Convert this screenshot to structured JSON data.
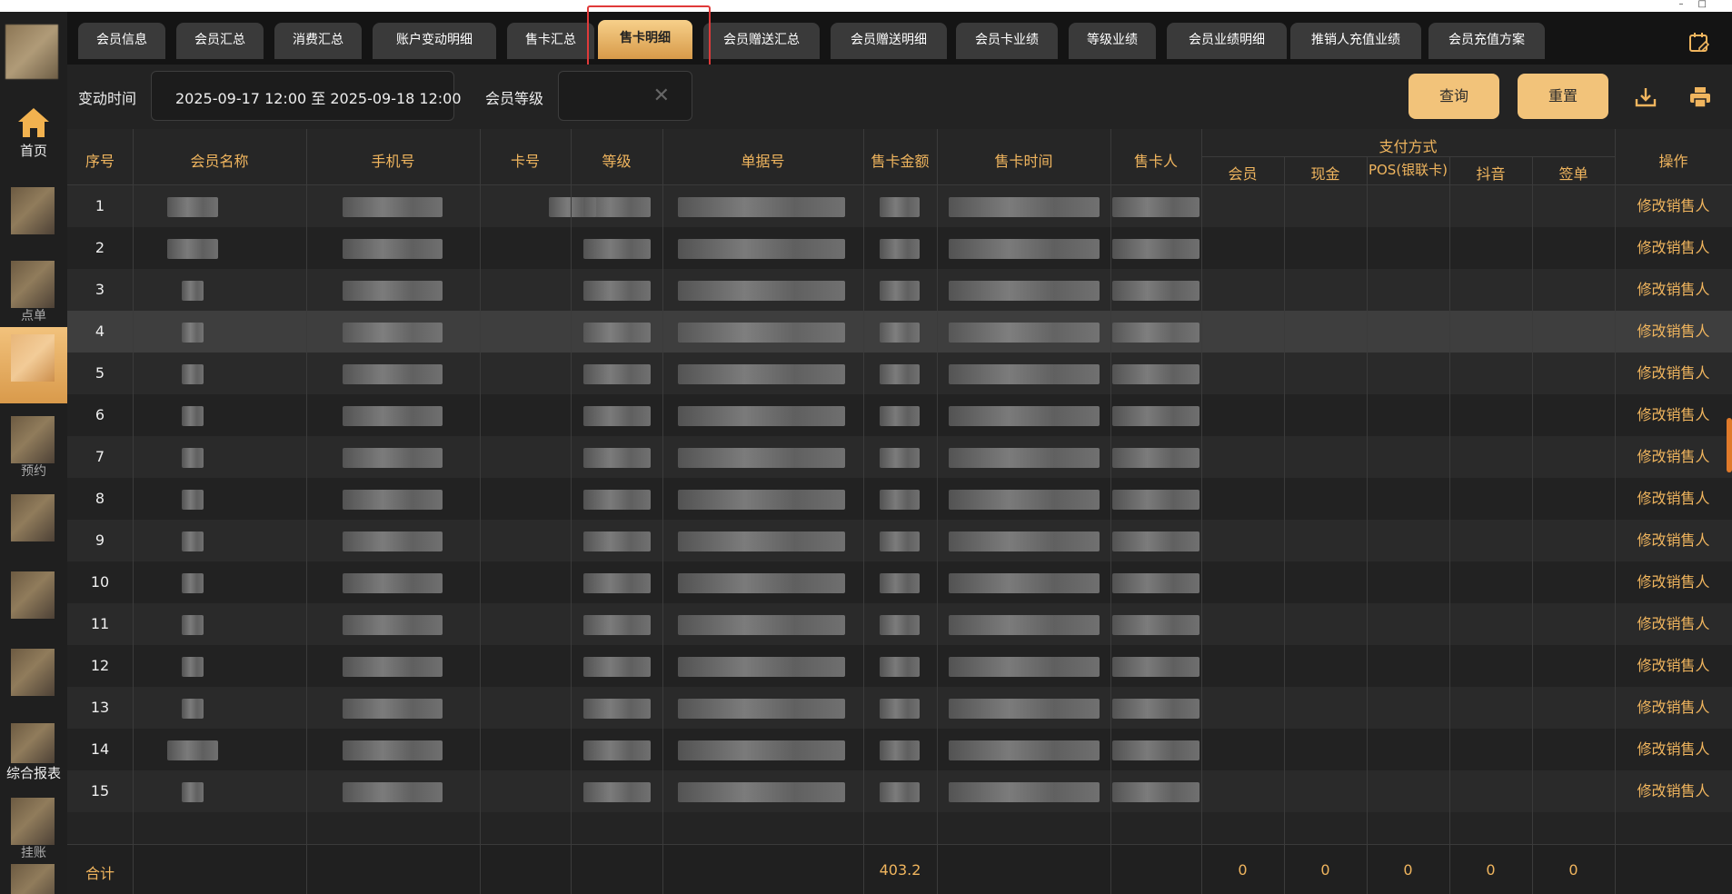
{
  "sidebar": {
    "items": [
      {
        "label": "首页",
        "icon": "home-icon"
      },
      {
        "label": ""
      },
      {
        "label": "点单"
      },
      {
        "label": ""
      },
      {
        "label": "预约"
      },
      {
        "label": ""
      },
      {
        "label": ""
      },
      {
        "label": ""
      },
      {
        "label": "综合报表"
      },
      {
        "label": "挂账"
      },
      {
        "label": ""
      }
    ]
  },
  "tabs": [
    {
      "label": "会员信息"
    },
    {
      "label": "会员汇总"
    },
    {
      "label": "消费汇总"
    },
    {
      "label": "账户变动明细"
    },
    {
      "label": "售卡汇总"
    },
    {
      "label": "售卡明细",
      "active": true
    },
    {
      "label": "会员赠送汇总"
    },
    {
      "label": "会员赠送明细"
    },
    {
      "label": "会员卡业绩"
    },
    {
      "label": "等级业绩"
    },
    {
      "label": "会员业绩明细"
    },
    {
      "label": "推销人充值业绩"
    },
    {
      "label": "会员充值方案"
    }
  ],
  "filters": {
    "time_label": "变动时间",
    "time_value": "2025-09-17 12:00  至  2025-09-18 12:00",
    "level_label": "会员等级",
    "level_value": "",
    "query_button": "查询",
    "reset_button": "重置"
  },
  "table": {
    "headers": {
      "index": "序号",
      "name": "会员名称",
      "phone": "手机号",
      "card_no": "卡号",
      "level": "等级",
      "order_no": "单据号",
      "amount": "售卡金额",
      "sale_time": "售卡时间",
      "seller": "售卡人",
      "payment_group": "支付方式",
      "pay_member": "会员",
      "pay_cash": "现金",
      "pay_pos": "POS(银联卡)",
      "pay_douyin": "抖音",
      "pay_sign": "签单",
      "action": "操作"
    },
    "rows": [
      {
        "index": "1",
        "action": "修改销售人"
      },
      {
        "index": "2",
        "action": "修改销售人"
      },
      {
        "index": "3",
        "action": "修改销售人"
      },
      {
        "index": "4",
        "action": "修改销售人"
      },
      {
        "index": "5",
        "action": "修改销售人"
      },
      {
        "index": "6",
        "action": "修改销售人"
      },
      {
        "index": "7",
        "action": "修改销售人"
      },
      {
        "index": "8",
        "action": "修改销售人"
      },
      {
        "index": "9",
        "action": "修改销售人"
      },
      {
        "index": "10",
        "action": "修改销售人"
      },
      {
        "index": "11",
        "action": "修改销售人"
      },
      {
        "index": "12",
        "action": "修改销售人"
      },
      {
        "index": "13",
        "action": "修改销售人"
      },
      {
        "index": "14",
        "action": "修改销售人"
      },
      {
        "index": "15",
        "action": "修改销售人"
      }
    ],
    "footer": {
      "label": "合计",
      "amount": "403.2",
      "pay_member": "0",
      "pay_cash": "0",
      "pay_pos": "0",
      "pay_douyin": "0",
      "pay_sign": "0"
    }
  },
  "colors": {
    "accent": "#f0b55e",
    "button": "#f2c37a",
    "background": "#1c1c1c",
    "highlight_box": "#e03a3a"
  }
}
